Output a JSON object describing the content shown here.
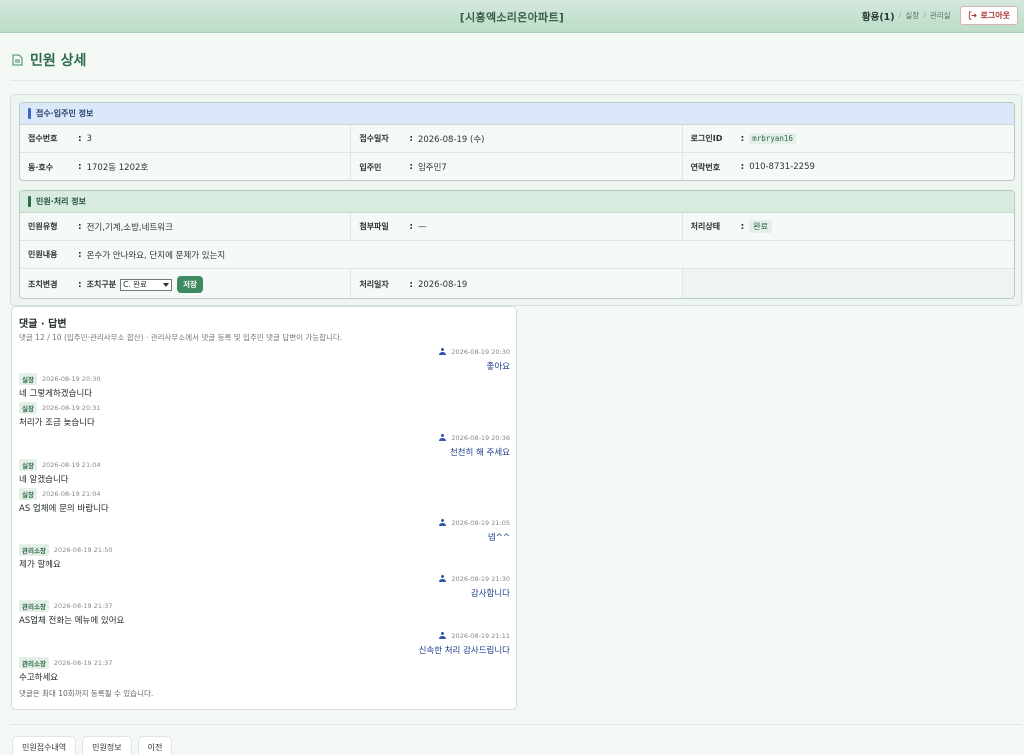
{
  "header": {
    "site_title": "[시흥엑소리온아파트]",
    "user_name": "황용(1)",
    "role_1": "실장",
    "role_2": "관리실",
    "logout_label": "로그아웃",
    "logout_icon": "logout-icon"
  },
  "page": {
    "title": "민원 상세",
    "title_icon": "document-icon"
  },
  "section_1": {
    "title": "접수·입주민 정보",
    "rows": [
      [
        {
          "label": "접수번호",
          "value": "3"
        },
        {
          "label": "접수일자",
          "value": "2026-08-19 (수)"
        },
        {
          "label": "로그인ID",
          "value": "mrbryan16"
        }
      ],
      [
        {
          "label": "동·호수",
          "value": "1702동 1202호"
        },
        {
          "label": "입주민",
          "value": "임주민7"
        },
        {
          "label": "연락번호",
          "value": "010-8731-2259"
        }
      ]
    ]
  },
  "section_2": {
    "title": "민원·처리 정보",
    "type_label": "민원유형",
    "type_value": "전기,기계,소방,네트워크",
    "attach_label": "첨부파일",
    "attach_value": "—",
    "status_label": "처리상태",
    "status_value": "완료",
    "content_label": "민원내용",
    "content_value": "온수가 안나와요, 단지에 문제가 있는지",
    "action_label": "조치변경",
    "action_sub_label": "조치구분",
    "action_selected": "C. 완료",
    "save_label": "저장",
    "done_date_label": "처리일자",
    "done_date_value": "2026-08-19"
  },
  "comments": {
    "title": "댓글 · 답변",
    "subtitle": "댓글 12 / 10 (입주민·관리사무소 합산) · 관리사무소에서 댓글 등록 및 입주민 댓글 답변이 가능합니다.",
    "items": [
      {
        "side": "right",
        "badge": "",
        "time": "2026-08-19 20:30",
        "text": "좋아요"
      },
      {
        "side": "left",
        "badge": "실장",
        "time": "2026-08-19 20:30",
        "text": "네 그렇게하겠습니다"
      },
      {
        "side": "left",
        "badge": "실장",
        "time": "2026-08-19 20:31",
        "text": "처리가 조금 늦습니다"
      },
      {
        "side": "right",
        "badge": "",
        "time": "2026-08-19 20:36",
        "text": "천천히 해 주세요"
      },
      {
        "side": "left",
        "badge": "실장",
        "time": "2026-08-19 21:04",
        "text": "네 알겠습니다"
      },
      {
        "side": "left",
        "badge": "실장",
        "time": "2026-08-19 21:04",
        "text": "AS 업체에 문의 바랍니다"
      },
      {
        "side": "right",
        "badge": "",
        "time": "2026-08-19 21:05",
        "text": "넵^^"
      },
      {
        "side": "left",
        "badge": "관리소장",
        "time": "2026-08-19 21:50",
        "text": "제가 할께요"
      },
      {
        "side": "right",
        "badge": "",
        "time": "2026-08-19 21:30",
        "text": "감사합니다"
      },
      {
        "side": "left",
        "badge": "관리소장",
        "time": "2026-08-19 21:37",
        "text": "AS업체 전화는 메뉴에 있어요"
      },
      {
        "side": "right",
        "badge": "",
        "time": "2026-08-19 21:11",
        "text": "신속한 처리 감사드립니다"
      },
      {
        "side": "left",
        "badge": "관리소장",
        "time": "2026-08-19 21:37",
        "text": "수고하세요"
      }
    ],
    "limit_note": "댓글은 최대 10회까지 등록될 수 있습니다."
  },
  "bottom_tabs": [
    "민원접수내역",
    "민원정보",
    "이전"
  ]
}
